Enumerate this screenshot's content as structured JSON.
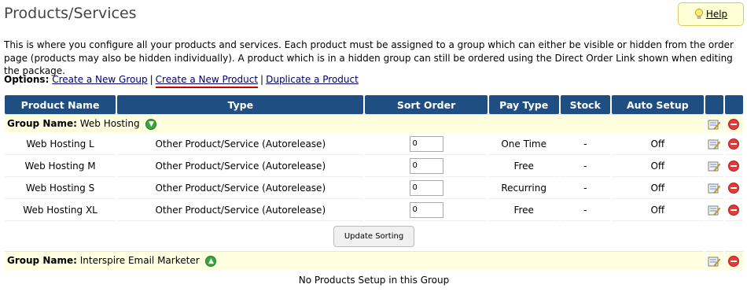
{
  "header": {
    "title": "Products/Services",
    "help_label": "Help"
  },
  "intro": "This is where you configure all your products and services. Each product must be assigned to a group which can either be visible or hidden from the order page (products may also be hidden individually). A product which is in a hidden group can still be ordered using the Direct Order Link shown when editing the package.",
  "options": {
    "label": "Options:",
    "links": [
      "Create a New Group",
      "Create a New Product",
      "Duplicate a Product"
    ],
    "separator": "|"
  },
  "table": {
    "columns": [
      "Product Name",
      "Type",
      "Sort Order",
      "Pay Type",
      "Stock",
      "Auto Setup",
      "",
      ""
    ],
    "group_prefix": "Group Name:",
    "groups": [
      {
        "name": "Web Hosting",
        "products": [
          {
            "name": "Web Hosting L",
            "type": "Other Product/Service (Autorelease)",
            "sort": "0",
            "pay_type": "One Time",
            "stock": "-",
            "auto_setup": "Off"
          },
          {
            "name": "Web Hosting M",
            "type": "Other Product/Service (Autorelease)",
            "sort": "0",
            "pay_type": "Free",
            "stock": "-",
            "auto_setup": "Off"
          },
          {
            "name": "Web Hosting S",
            "type": "Other Product/Service (Autorelease)",
            "sort": "0",
            "pay_type": "Recurring",
            "stock": "-",
            "auto_setup": "Off"
          },
          {
            "name": "Web Hosting XL",
            "type": "Other Product/Service (Autorelease)",
            "sort": "0",
            "pay_type": "Free",
            "stock": "-",
            "auto_setup": "Off"
          }
        ],
        "update_label": "Update Sorting"
      },
      {
        "name": "Interspire Email Marketer",
        "empty_message": "No Products Setup in this Group"
      }
    ]
  },
  "icons": {
    "help": "lightbulb-icon",
    "edit": "edit-icon",
    "delete": "delete-icon",
    "group_toggle": "arrow-up-icon"
  },
  "colors": {
    "header_bg": "#1f4e83",
    "group_bg": "#ffffe0",
    "help_bg": "#ffffd5",
    "link": "#000066",
    "highlight_underline": "#cc0000"
  }
}
